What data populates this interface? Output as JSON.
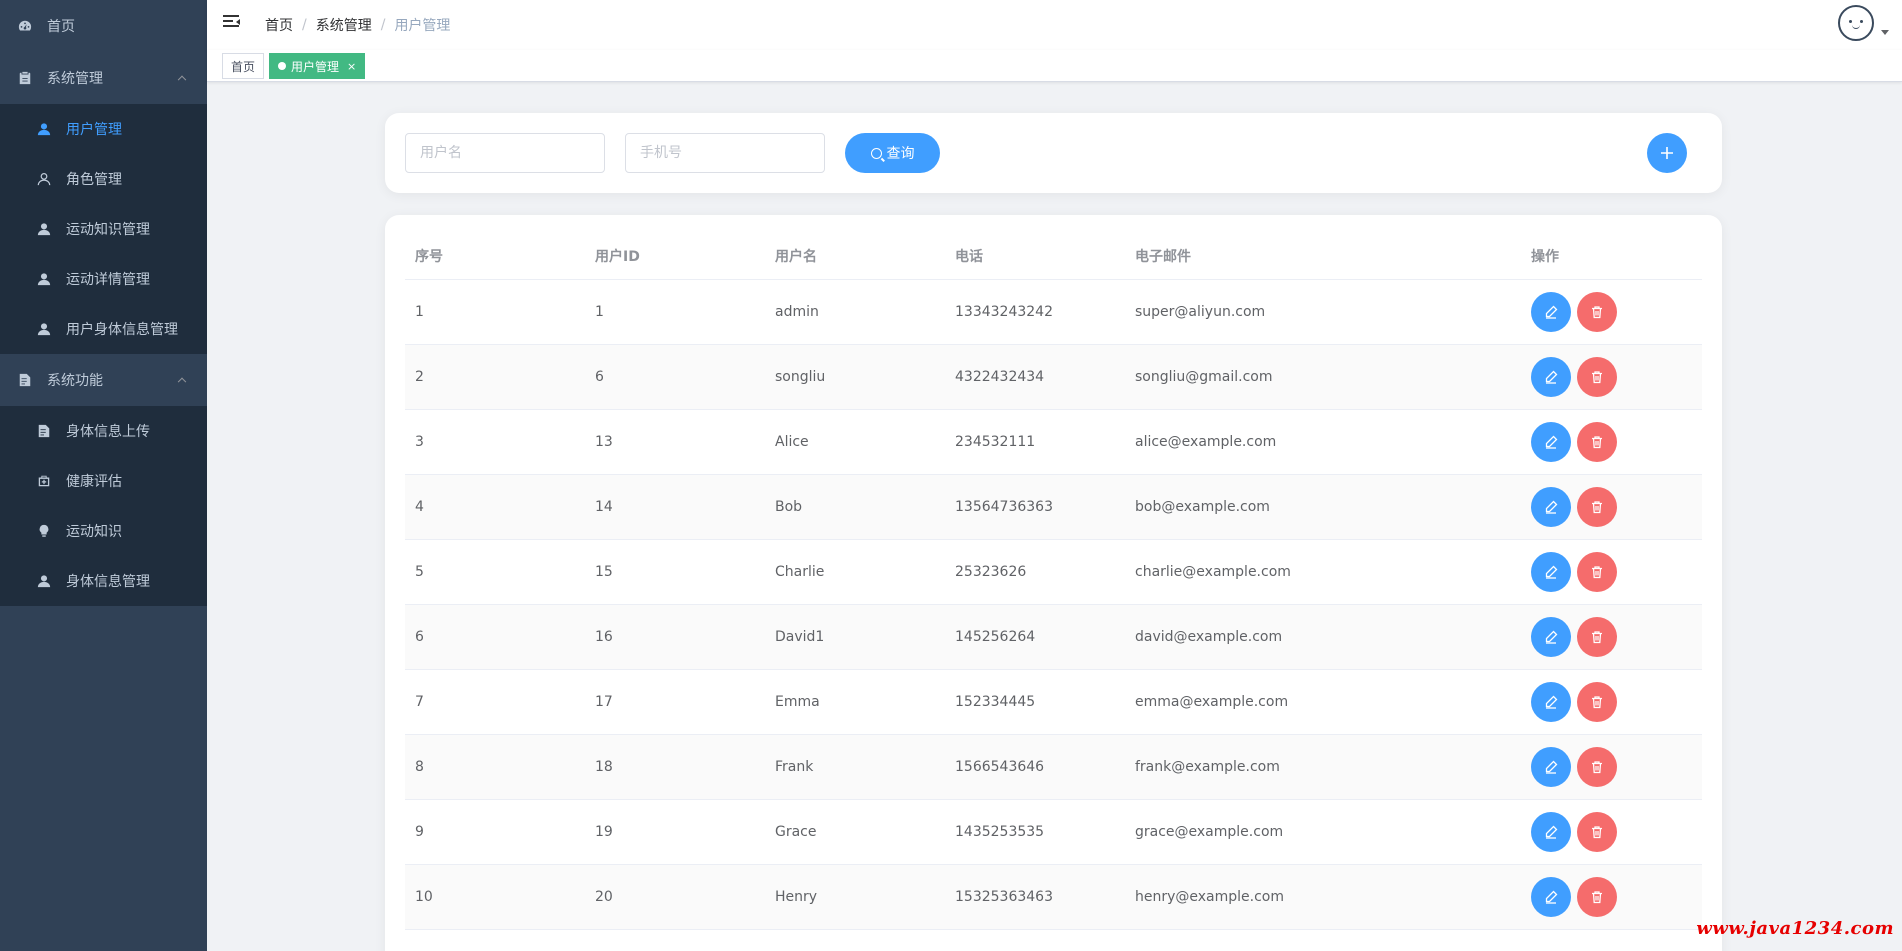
{
  "sidebar": {
    "items": [
      {
        "label": "首页",
        "icon": "dashboard-icon",
        "level": 1
      },
      {
        "label": "系统管理",
        "icon": "clipboard-icon",
        "level": 1,
        "expanded": true,
        "children": [
          {
            "label": "用户管理",
            "icon": "user-icon",
            "active": true
          },
          {
            "label": "角色管理",
            "icon": "user-outline-icon"
          },
          {
            "label": "运动知识管理",
            "icon": "user-icon"
          },
          {
            "label": "运动详情管理",
            "icon": "user-icon"
          },
          {
            "label": "用户身体信息管理",
            "icon": "user-icon"
          }
        ]
      },
      {
        "label": "系统功能",
        "icon": "document-icon",
        "level": 1,
        "expanded": true,
        "children": [
          {
            "label": "身体信息上传",
            "icon": "document-icon"
          },
          {
            "label": "健康评估",
            "icon": "medical-kit-icon"
          },
          {
            "label": "运动知识",
            "icon": "bulb-icon"
          },
          {
            "label": "身体信息管理",
            "icon": "user-icon"
          }
        ]
      }
    ]
  },
  "navbar": {
    "breadcrumb": [
      "首页",
      "系统管理",
      "用户管理"
    ],
    "separator": "/"
  },
  "tags": [
    {
      "label": "首页",
      "active": false
    },
    {
      "label": "用户管理",
      "active": true,
      "close": "×"
    }
  ],
  "search": {
    "username_placeholder": "用户名",
    "phone_placeholder": "手机号",
    "query_label": "查询"
  },
  "table": {
    "headers": [
      "序号",
      "用户ID",
      "用户名",
      "电话",
      "电子邮件",
      "操作"
    ],
    "rows": [
      [
        "1",
        "1",
        "admin",
        "13343243242",
        "super@aliyun.com"
      ],
      [
        "2",
        "6",
        "songliu",
        "4322432434",
        "songliu@gmail.com"
      ],
      [
        "3",
        "13",
        "Alice",
        "234532111",
        "alice@example.com"
      ],
      [
        "4",
        "14",
        "Bob",
        "13564736363",
        "bob@example.com"
      ],
      [
        "5",
        "15",
        "Charlie",
        "25323626",
        "charlie@example.com"
      ],
      [
        "6",
        "16",
        "David1",
        "145256264",
        "david@example.com"
      ],
      [
        "7",
        "17",
        "Emma",
        "152334445",
        "emma@example.com"
      ],
      [
        "8",
        "18",
        "Frank",
        "1566543646",
        "frank@example.com"
      ],
      [
        "9",
        "19",
        "Grace",
        "1435253535",
        "grace@example.com"
      ],
      [
        "10",
        "20",
        "Henry",
        "15325363463",
        "henry@example.com"
      ]
    ]
  },
  "watermark": "www.java1234.com",
  "colors": {
    "sidebar_bg": "#304156",
    "submenu_bg": "#1f2d3d",
    "primary": "#409eff",
    "danger": "#f56c6c",
    "tag_active": "#42b983"
  }
}
